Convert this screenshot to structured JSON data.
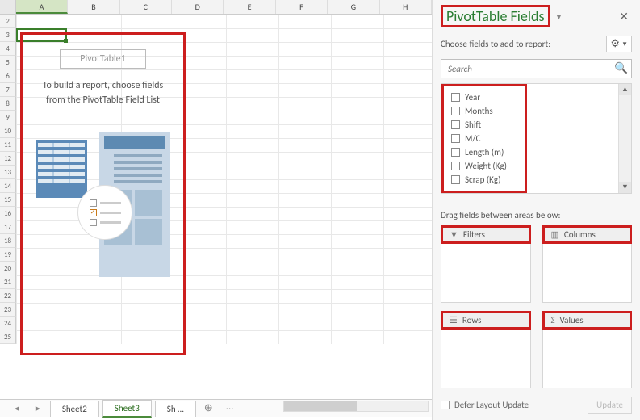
{
  "spreadsheet": {
    "columns": [
      "A",
      "B",
      "C",
      "D",
      "E",
      "F",
      "G",
      "H"
    ],
    "row_start": 2,
    "row_end": 25,
    "selected_cell_ref": "A3",
    "pivot_name": "PivotTable1",
    "pivot_help_text": "To build a report, choose fields from the PivotTable Field List"
  },
  "sheet_tabs": {
    "tabs": [
      "Sheet2",
      "Sheet3",
      "Sh …"
    ],
    "active_index": 1
  },
  "pane": {
    "title": "PivotTable Fields",
    "subtitle": "Choose fields to add to report:",
    "search_placeholder": "Search",
    "fields": [
      "Year",
      "Months",
      "Shift",
      "M/C",
      "Length (m)",
      "Weight (Kg)",
      "Scrap (Kg)"
    ],
    "drag_label": "Drag fields between areas below:",
    "areas": {
      "filters": "Filters",
      "columns": "Columns",
      "rows": "Rows",
      "values": "Values"
    },
    "defer_label": "Defer Layout Update",
    "update_label": "Update"
  }
}
